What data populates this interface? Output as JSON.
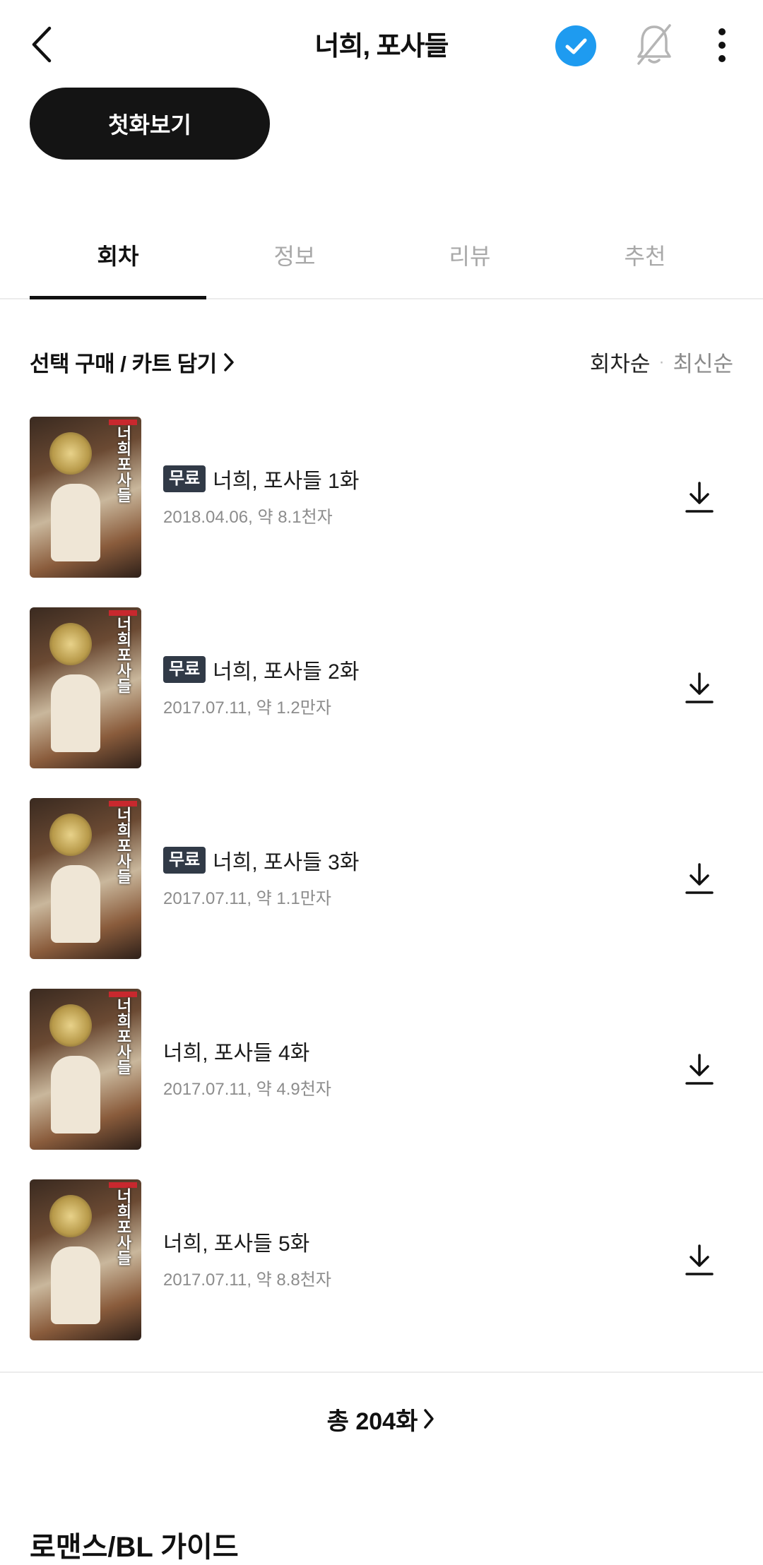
{
  "header": {
    "title": "너희, 포사들"
  },
  "actions": {
    "first_episode": "첫화보기"
  },
  "tabs": [
    {
      "label": "회차"
    },
    {
      "label": "정보"
    },
    {
      "label": "리뷰"
    },
    {
      "label": "추천"
    }
  ],
  "toolbar": {
    "select_cart": "선택 구매 / 카트 담기",
    "sort_episode": "회차순",
    "sort_separator": "·",
    "sort_latest": "최신순"
  },
  "free_badge": "무료",
  "episodes": [
    {
      "title": "너희, 포사들 1화",
      "meta": "2018.04.06, 약 8.1천자",
      "free": true
    },
    {
      "title": "너희, 포사들 2화",
      "meta": "2017.07.11, 약 1.2만자",
      "free": true
    },
    {
      "title": "너희, 포사들 3화",
      "meta": "2017.07.11, 약 1.1만자",
      "free": true
    },
    {
      "title": "너희, 포사들 4화",
      "meta": "2017.07.11, 약 4.9천자",
      "free": false
    },
    {
      "title": "너희, 포사들 5화",
      "meta": "2017.07.11, 약 8.8천자",
      "free": false
    }
  ],
  "thumbnail_glyph": "너희포사들",
  "total": {
    "label": "총 204화"
  },
  "section": {
    "title": "로맨스/BL 가이드"
  },
  "colors": {
    "accent_blue": "#1e9bf0",
    "badge_bg": "#313a47"
  }
}
